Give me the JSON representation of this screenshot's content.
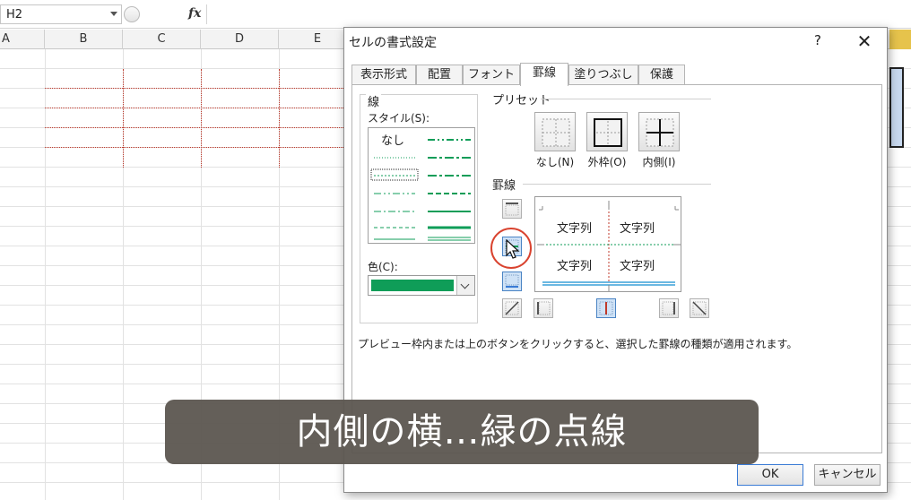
{
  "formula_bar": {
    "name_box": "H2",
    "fx_label": "fx"
  },
  "sheet": {
    "columns": [
      "A",
      "B",
      "C",
      "D",
      "E"
    ]
  },
  "dialog": {
    "title": "セルの書式設定",
    "help": "?",
    "close": "✕",
    "tabs": [
      {
        "label": "表示形式",
        "active": false
      },
      {
        "label": "配置",
        "active": false
      },
      {
        "label": "フォント",
        "active": false
      },
      {
        "label": "罫線",
        "active": true
      },
      {
        "label": "塗りつぶし",
        "active": false
      },
      {
        "label": "保護",
        "active": false
      }
    ],
    "line_group": {
      "title": "線",
      "style_label": "スタイル(S):",
      "none_label": "なし",
      "color_label": "色(C):",
      "selected_color": "#0f9d58"
    },
    "preset": {
      "title": "プリセット",
      "buttons": [
        {
          "label": "なし(N)",
          "icon": "preset-none-icon"
        },
        {
          "label": "外枠(O)",
          "icon": "preset-outline-icon"
        },
        {
          "label": "内側(I)",
          "icon": "preset-inside-icon"
        }
      ]
    },
    "border": {
      "title": "罫線",
      "preview_cells": [
        "文字列",
        "文字列",
        "文字列",
        "文字列"
      ]
    },
    "hint": "プレビュー枠内または上のボタンをクリックすると、選択した罫線の種類が適用されます。",
    "ok": "OK",
    "cancel": "キャンセル"
  },
  "caption": "内側の横…緑の点線",
  "colors": {
    "accent_green": "#0f9d58",
    "red_border": "#c0392b",
    "highlight_circle": "#d9432f"
  }
}
